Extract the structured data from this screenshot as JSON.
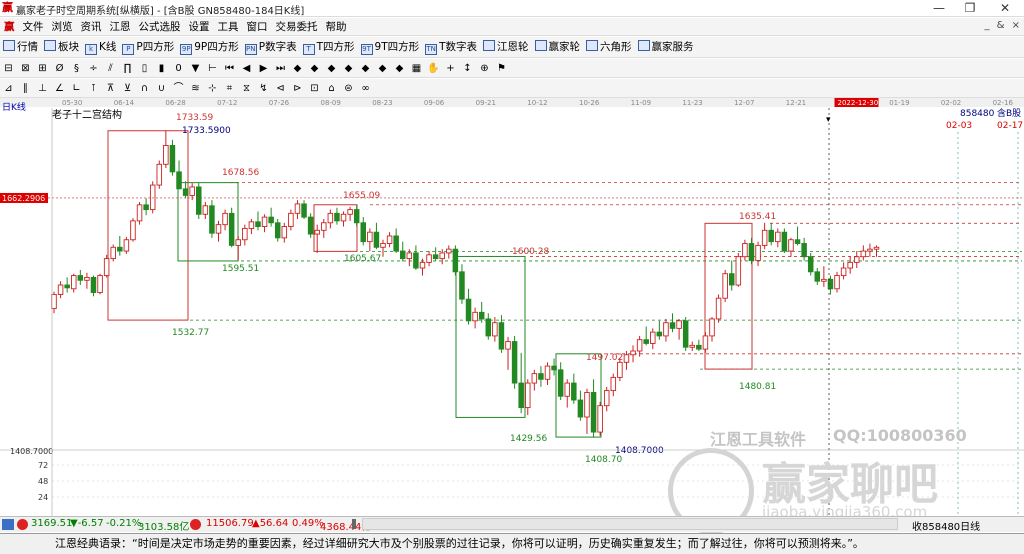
{
  "window": {
    "title": "赢家老子时空周期系统[纵横版] - [含B股  GN858480-184日K线]",
    "app_icon": "赢",
    "minimize": "—",
    "restore": "❐",
    "close": "✕"
  },
  "menu": {
    "items": [
      "文件",
      "浏览",
      "资讯",
      "江恩",
      "公式选股",
      "设置",
      "工具",
      "窗口",
      "交易委托",
      "帮助"
    ],
    "mdi_controls": "_ & ×"
  },
  "toolbar": {
    "items": [
      {
        "icon": "grid",
        "label": "行情"
      },
      {
        "icon": "blocks",
        "label": "板块"
      },
      {
        "icon": "k",
        "label": "K线"
      },
      {
        "icon": "P",
        "label": "P四方形"
      },
      {
        "icon": "9P",
        "label": "9P四方形"
      },
      {
        "icon": "PN",
        "label": "P数字表"
      },
      {
        "icon": "T",
        "label": "T四方形"
      },
      {
        "icon": "9T",
        "label": "9T四方形"
      },
      {
        "icon": "TN",
        "label": "T数字表"
      },
      {
        "icon": "wheel",
        "label": "江恩轮"
      },
      {
        "icon": "wheel2",
        "label": "赢家轮"
      },
      {
        "icon": "hex",
        "label": "六角形"
      },
      {
        "icon": "service",
        "label": "赢家服务"
      }
    ]
  },
  "toolbar2_icons": [
    "⊟",
    "⊠",
    "⊞",
    "Ø",
    "§",
    "÷",
    "⫽",
    "∏",
    "▯",
    "▮",
    "0",
    "▼",
    "⊢",
    "⏮",
    "◀",
    "▶",
    "⏭",
    "◆",
    "◆",
    "◆",
    "◆",
    "◆",
    "◆",
    "◆",
    "▦",
    "✋",
    "+",
    "↕",
    "⊕",
    "⚑"
  ],
  "toolbar3_icons": [
    "⊿",
    "∥",
    "⊥",
    "∠",
    "∟",
    "⊺",
    "⊼",
    "⊻",
    "∩",
    "∪",
    "⌒",
    "≋",
    "⊹",
    "⌗",
    "⧖",
    "↯",
    "⊲",
    "⊳",
    "⊡",
    "⌂",
    "⊜",
    "∞"
  ],
  "chart_data": {
    "type": "candlestick",
    "title": "老子十二宫结构",
    "period_label": "日K线",
    "timeline_labels": [
      "05-30",
      "06-14",
      "06-28",
      "07-12",
      "07-26",
      "08-09",
      "08-23",
      "09-06",
      "09-21",
      "10-12",
      "10-26",
      "11-09",
      "11-23",
      "12-07",
      "12-21",
      "2022-12-30",
      "01-19",
      "02-02",
      "02-16"
    ],
    "current_date_label": "2022-12-30",
    "price_axis": {
      "labels": [
        "1408.7000",
        "72",
        "48",
        "24"
      ],
      "left_price_tag": "1662.2906",
      "ylim": [
        1395,
        1745
      ]
    },
    "right_labels": {
      "code": "858480",
      "name": "含B股",
      "date1": "02-03",
      "date2": "02-17"
    },
    "candles": [
      [
        1545,
        1563,
        1540,
        1560
      ],
      [
        1560,
        1574,
        1556,
        1570
      ],
      [
        1570,
        1578,
        1562,
        1567
      ],
      [
        1566,
        1582,
        1562,
        1580
      ],
      [
        1580,
        1586,
        1570,
        1575
      ],
      [
        1575,
        1583,
        1566,
        1578
      ],
      [
        1578,
        1580,
        1558,
        1562
      ],
      [
        1562,
        1582,
        1560,
        1580
      ],
      [
        1580,
        1602,
        1578,
        1598
      ],
      [
        1598,
        1613,
        1595,
        1610
      ],
      [
        1610,
        1622,
        1601,
        1606
      ],
      [
        1606,
        1621,
        1603,
        1618
      ],
      [
        1618,
        1641,
        1616,
        1638
      ],
      [
        1638,
        1658,
        1634,
        1655
      ],
      [
        1655,
        1662,
        1644,
        1650
      ],
      [
        1650,
        1680,
        1646,
        1676
      ],
      [
        1676,
        1702,
        1672,
        1698
      ],
      [
        1698,
        1734,
        1694,
        1718
      ],
      [
        1718,
        1724,
        1686,
        1690
      ],
      [
        1690,
        1702,
        1682,
        1672
      ],
      [
        1672,
        1680,
        1662,
        1665
      ],
      [
        1665,
        1678,
        1660,
        1674
      ],
      [
        1674,
        1678,
        1640,
        1645
      ],
      [
        1645,
        1658,
        1640,
        1654
      ],
      [
        1654,
        1660,
        1620,
        1625
      ],
      [
        1625,
        1638,
        1616,
        1634
      ],
      [
        1634,
        1650,
        1628,
        1646
      ],
      [
        1646,
        1652,
        1610,
        1612
      ],
      [
        1612,
        1622,
        1596,
        1618
      ],
      [
        1618,
        1634,
        1612,
        1630
      ],
      [
        1630,
        1640,
        1624,
        1637
      ],
      [
        1637,
        1648,
        1628,
        1632
      ],
      [
        1632,
        1645,
        1626,
        1642
      ],
      [
        1642,
        1652,
        1632,
        1636
      ],
      [
        1636,
        1640,
        1616,
        1620
      ],
      [
        1620,
        1636,
        1615,
        1632
      ],
      [
        1632,
        1650,
        1628,
        1646
      ],
      [
        1646,
        1660,
        1640,
        1656
      ],
      [
        1656,
        1660,
        1640,
        1642
      ],
      [
        1642,
        1646,
        1620,
        1624
      ],
      [
        1624,
        1634,
        1604,
        1628
      ],
      [
        1628,
        1640,
        1620,
        1636
      ],
      [
        1636,
        1650,
        1630,
        1646
      ],
      [
        1646,
        1652,
        1634,
        1638
      ],
      [
        1638,
        1648,
        1632,
        1645
      ],
      [
        1645,
        1653,
        1638,
        1650
      ],
      [
        1650,
        1655,
        1632,
        1636
      ],
      [
        1636,
        1642,
        1612,
        1616
      ],
      [
        1616,
        1630,
        1606,
        1626
      ],
      [
        1626,
        1636,
        1608,
        1610
      ],
      [
        1610,
        1618,
        1600,
        1614
      ],
      [
        1614,
        1626,
        1610,
        1622
      ],
      [
        1622,
        1630,
        1604,
        1606
      ],
      [
        1606,
        1616,
        1595,
        1598
      ],
      [
        1598,
        1608,
        1590,
        1604
      ],
      [
        1604,
        1612,
        1586,
        1588
      ],
      [
        1588,
        1598,
        1580,
        1594
      ],
      [
        1594,
        1606,
        1590,
        1602
      ],
      [
        1602,
        1610,
        1596,
        1598
      ],
      [
        1598,
        1608,
        1592,
        1604
      ],
      [
        1604,
        1612,
        1598,
        1608
      ],
      [
        1608,
        1612,
        1580,
        1584
      ],
      [
        1584,
        1592,
        1550,
        1555
      ],
      [
        1555,
        1566,
        1528,
        1532
      ],
      [
        1532,
        1546,
        1524,
        1541
      ],
      [
        1541,
        1552,
        1530,
        1534
      ],
      [
        1534,
        1540,
        1512,
        1516
      ],
      [
        1516,
        1536,
        1510,
        1530
      ],
      [
        1530,
        1538,
        1498,
        1502
      ],
      [
        1502,
        1515,
        1480,
        1510
      ],
      [
        1510,
        1516,
        1460,
        1466
      ],
      [
        1466,
        1498,
        1434,
        1440
      ],
      [
        1440,
        1470,
        1432,
        1466
      ],
      [
        1466,
        1480,
        1458,
        1476
      ],
      [
        1476,
        1484,
        1462,
        1470
      ],
      [
        1470,
        1488,
        1464,
        1484
      ],
      [
        1484,
        1492,
        1474,
        1480
      ],
      [
        1480,
        1488,
        1448,
        1452
      ],
      [
        1452,
        1470,
        1440,
        1466
      ],
      [
        1466,
        1476,
        1444,
        1448
      ],
      [
        1448,
        1458,
        1426,
        1430
      ],
      [
        1430,
        1460,
        1412,
        1456
      ],
      [
        1456,
        1470,
        1408,
        1414
      ],
      [
        1414,
        1446,
        1410,
        1442
      ],
      [
        1442,
        1462,
        1436,
        1458
      ],
      [
        1458,
        1476,
        1452,
        1472
      ],
      [
        1472,
        1492,
        1468,
        1488
      ],
      [
        1488,
        1500,
        1480,
        1496
      ],
      [
        1496,
        1506,
        1488,
        1500
      ],
      [
        1500,
        1516,
        1494,
        1512
      ],
      [
        1512,
        1526,
        1506,
        1508
      ],
      [
        1508,
        1524,
        1502,
        1520
      ],
      [
        1520,
        1532,
        1512,
        1516
      ],
      [
        1516,
        1534,
        1510,
        1530
      ],
      [
        1530,
        1540,
        1520,
        1524
      ],
      [
        1524,
        1534,
        1512,
        1532
      ],
      [
        1532,
        1536,
        1500,
        1504
      ],
      [
        1504,
        1510,
        1500,
        1506
      ],
      [
        1506,
        1512,
        1500,
        1502
      ],
      [
        1502,
        1520,
        1498,
        1516
      ],
      [
        1516,
        1536,
        1510,
        1534
      ],
      [
        1534,
        1560,
        1530,
        1556
      ],
      [
        1556,
        1586,
        1552,
        1582
      ],
      [
        1582,
        1596,
        1564,
        1570
      ],
      [
        1570,
        1604,
        1568,
        1600
      ],
      [
        1600,
        1618,
        1596,
        1614
      ],
      [
        1614,
        1620,
        1592,
        1596
      ],
      [
        1596,
        1616,
        1590,
        1612
      ],
      [
        1612,
        1636,
        1608,
        1628
      ],
      [
        1628,
        1636,
        1612,
        1616
      ],
      [
        1616,
        1630,
        1610,
        1626
      ],
      [
        1626,
        1630,
        1604,
        1606
      ],
      [
        1606,
        1620,
        1600,
        1618
      ],
      [
        1618,
        1632,
        1612,
        1614
      ],
      [
        1614,
        1620,
        1596,
        1600
      ],
      [
        1600,
        1604,
        1580,
        1584
      ],
      [
        1584,
        1588,
        1570,
        1574
      ],
      [
        1574,
        1590,
        1568,
        1576
      ],
      [
        1576,
        1580,
        1560,
        1566
      ],
      [
        1566,
        1584,
        1562,
        1580
      ],
      [
        1580,
        1594,
        1576,
        1588
      ],
      [
        1588,
        1600,
        1582,
        1594
      ],
      [
        1594,
        1606,
        1588,
        1600
      ],
      [
        1600,
        1612,
        1596,
        1606
      ],
      [
        1606,
        1614,
        1600,
        1608
      ],
      [
        1608,
        1612,
        1600,
        1610
      ]
    ],
    "annotations": [
      {
        "text": "1733.59",
        "price": 1733.59,
        "color": "#cc3333"
      },
      {
        "text": "1733.5900",
        "price": 1733.59,
        "color": "#000080"
      },
      {
        "text": "1678.56",
        "price": 1678.56,
        "color": "#cc3333"
      },
      {
        "text": "1655.09",
        "price": 1655.09,
        "color": "#cc3333"
      },
      {
        "text": "1635.41",
        "price": 1635.41,
        "color": "#cc3333"
      },
      {
        "text": "1600.28",
        "price": 1600.28,
        "color": "#cc3333"
      },
      {
        "text": "1605.67",
        "price": 1605.67,
        "color": "#228822"
      },
      {
        "text": "1595.51",
        "price": 1595.51,
        "color": "#228822"
      },
      {
        "text": "1532.77",
        "price": 1532.77,
        "color": "#228822"
      },
      {
        "text": "1497.02",
        "price": 1497.02,
        "color": "#cc3333"
      },
      {
        "text": "1480.81",
        "price": 1480.81,
        "color": "#228822"
      },
      {
        "text": "1429.56",
        "price": 1429.56,
        "color": "#228822"
      },
      {
        "text": "1408.70",
        "price": 1408.7,
        "color": "#228822"
      },
      {
        "text": "1408.7000",
        "price": 1408.7,
        "color": "#000080"
      }
    ],
    "watermark": {
      "line1": "江恩工具软件",
      "line2": "QQ:100800360",
      "line3": "赢家聊吧",
      "line4": "jiaoba.yingjia360.com"
    },
    "colors": {
      "up": "#cc2222",
      "down": "#228822",
      "red_box": "#cc3333",
      "green_box": "#228822"
    }
  },
  "status": {
    "sh_index": "3169.51",
    "sh_change": "▼-6.57",
    "sh_pct": "-0.21%",
    "sh_amount": "3103.58亿",
    "sz_index": "11506.79",
    "sz_change": "▲56.64",
    "sz_pct": "0.49%",
    "sz_amount": "4368.44亿",
    "right": "收858480日线"
  },
  "quote": "江恩经典语录：“时间是决定市场走势的重要因素，经过详细研究大市及个别股票的过往记录，你将可以证明，历史确实重复发生；而了解过往，你将可以预测将来。”。"
}
